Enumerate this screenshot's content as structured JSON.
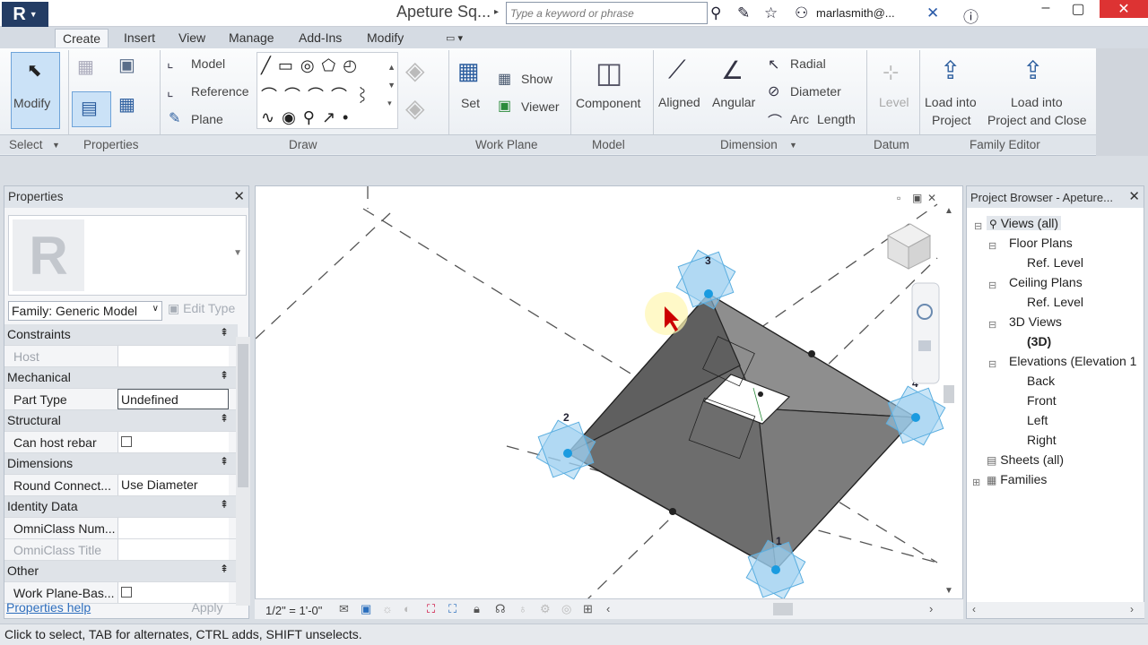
{
  "titlebar": {
    "app_letter": "R",
    "title": "Apeture Sq...",
    "search_placeholder": "Type a keyword or phrase",
    "user": "marlasmith@..."
  },
  "ribbon": {
    "tabs": [
      "Create",
      "Insert",
      "View",
      "Manage",
      "Add-Ins",
      "Modify"
    ],
    "active_tab": "Create",
    "select": {
      "modify_label": "Modify",
      "panel_label": "Select"
    },
    "properties": {
      "panel_label": "Properties"
    },
    "draw": {
      "model_label": "Model",
      "reference_label": "Reference",
      "plane_label": "Plane",
      "panel_label": "Draw"
    },
    "work_plane": {
      "set_label": "Set",
      "show_label": "Show",
      "viewer_label": "Viewer",
      "panel_label": "Work Plane"
    },
    "model": {
      "component_label": "Component",
      "panel_label": "Model"
    },
    "dimension": {
      "aligned_label": "Aligned",
      "angular_label": "Angular",
      "radial_label": "Radial",
      "diameter_label": "Diameter",
      "arc_label": "Arc",
      "length_label": "Length",
      "panel_label": "Dimension"
    },
    "datum": {
      "level_label": "Level",
      "panel_label": "Datum"
    },
    "family_editor": {
      "load_project_1": "Load into",
      "load_project_2": "Project",
      "load_close_1": "Load into",
      "load_close_2": "Project and Close",
      "panel_label": "Family Editor"
    }
  },
  "properties_panel": {
    "title": "Properties",
    "family_select": "Family: Generic Model",
    "edit_type": "Edit Type",
    "rows": [
      {
        "group": "Constraints"
      },
      {
        "name": "Host",
        "value": "",
        "dim": true
      },
      {
        "group": "Mechanical"
      },
      {
        "name": "Part Type",
        "value": "Undefined"
      },
      {
        "group": "Structural"
      },
      {
        "name": "Can host rebar",
        "checkbox": true
      },
      {
        "group": "Dimensions"
      },
      {
        "name": "Round Connect...",
        "value": "Use Diameter"
      },
      {
        "group": "Identity Data"
      },
      {
        "name": "OmniClass Num...",
        "value": ""
      },
      {
        "name": "OmniClass Title",
        "value": "",
        "dim": true
      },
      {
        "group": "Other"
      },
      {
        "name": "Work Plane-Bas...",
        "checkbox": true
      }
    ],
    "help_link": "Properties help",
    "apply": "Apply"
  },
  "viewport": {
    "scale": "1/2\" = 1'-0\"",
    "point_labels": [
      "1",
      "2",
      "3",
      "4"
    ]
  },
  "project_browser": {
    "title": "Project Browser - Apeture...",
    "nodes": [
      {
        "label": "Views (all)",
        "level": 0
      },
      {
        "label": "Floor Plans",
        "level": 1
      },
      {
        "label": "Ref. Level",
        "level": 2
      },
      {
        "label": "Ceiling Plans",
        "level": 1
      },
      {
        "label": "Ref. Level",
        "level": 2
      },
      {
        "label": "3D Views",
        "level": 1
      },
      {
        "label": "(3D)",
        "level": 2
      },
      {
        "label": "Elevations (Elevation 1",
        "level": 1
      },
      {
        "label": "Back",
        "level": 2
      },
      {
        "label": "Front",
        "level": 2
      },
      {
        "label": "Left",
        "level": 2
      },
      {
        "label": "Right",
        "level": 2
      },
      {
        "label": "Sheets (all)",
        "level": 0
      },
      {
        "label": "Families",
        "level": 0
      }
    ]
  },
  "status_bar": {
    "text": "Click to select, TAB for alternates, CTRL adds, SHIFT unselects."
  }
}
